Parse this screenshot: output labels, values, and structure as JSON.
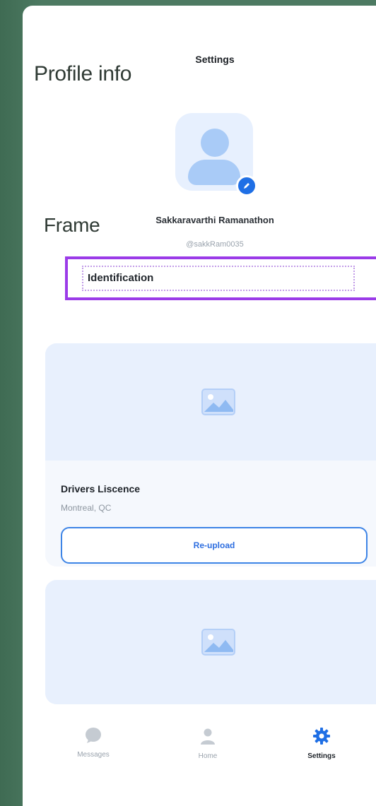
{
  "canvas": {
    "label_profile": "Profile info",
    "label_frame": "Frame"
  },
  "header": {
    "title": "Settings"
  },
  "profile": {
    "name": "Sakkaravarthi Ramanathon",
    "handle": "@sakkRam0035"
  },
  "identification": {
    "label": "Identification"
  },
  "cards": [
    {
      "title": "Drivers Liscence",
      "location": "Montreal, QC",
      "button_label": "Re-upload"
    },
    {
      "title": "",
      "location": ""
    }
  ],
  "bottom_nav": {
    "items": [
      {
        "label": "Messages",
        "icon": "chat-bubble-icon",
        "active": false
      },
      {
        "label": "Home",
        "icon": "person-icon",
        "active": false
      },
      {
        "label": "Settings",
        "icon": "gear-icon",
        "active": true
      }
    ]
  },
  "colors": {
    "background": "#4d7a62",
    "accent": "#1f6fe5",
    "selection": "#9b3be8",
    "card": "#f5f8fd"
  }
}
